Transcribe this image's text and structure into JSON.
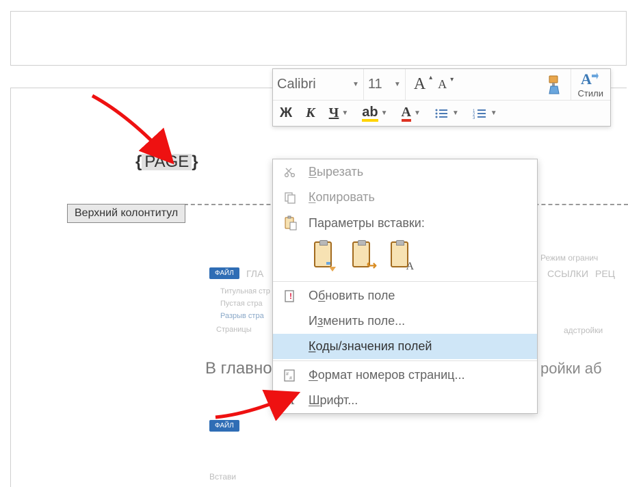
{
  "page_field": {
    "open": "{",
    "text": "PAGE",
    "close": "}"
  },
  "header_tag": "Верхний колонтитул",
  "mini_toolbar": {
    "font_name": "Calibri",
    "font_size": "11",
    "grow_font": "A",
    "shrink_font": "A",
    "styles_label": "Стили",
    "bold": "Ж",
    "italic": "К",
    "underline": "Ч",
    "highlight": "ab",
    "font_color": "A"
  },
  "context_menu": {
    "cut": "Вырезать",
    "copy": "Копировать",
    "paste_heading": "Параметры вставки:",
    "update_field": "Обновить поле",
    "edit_field": "Изменить поле...",
    "toggle_codes": "Коды/значения полей",
    "page_number_format": "Формат номеров страниц...",
    "font": "Шрифт..."
  },
  "background": {
    "file_tab": "ФАЙЛ",
    "glav": "ГЛА",
    "item1": "Титульная стр",
    "item2": "Пустая стра",
    "item3": "Разрыв стра",
    "item4": "Страницы",
    "main_text": "В главно",
    "right_top": "Режим огранич",
    "right_r1": "ССЫЛКИ",
    "right_r2": "РЕЦ",
    "right_ro": "ройки аб",
    "right_nad": "адстройки",
    "ins": "Встави"
  },
  "colors": {
    "highlight": "#ffd400",
    "font_color": "#d32f2f",
    "accent": "#2f6db5"
  }
}
